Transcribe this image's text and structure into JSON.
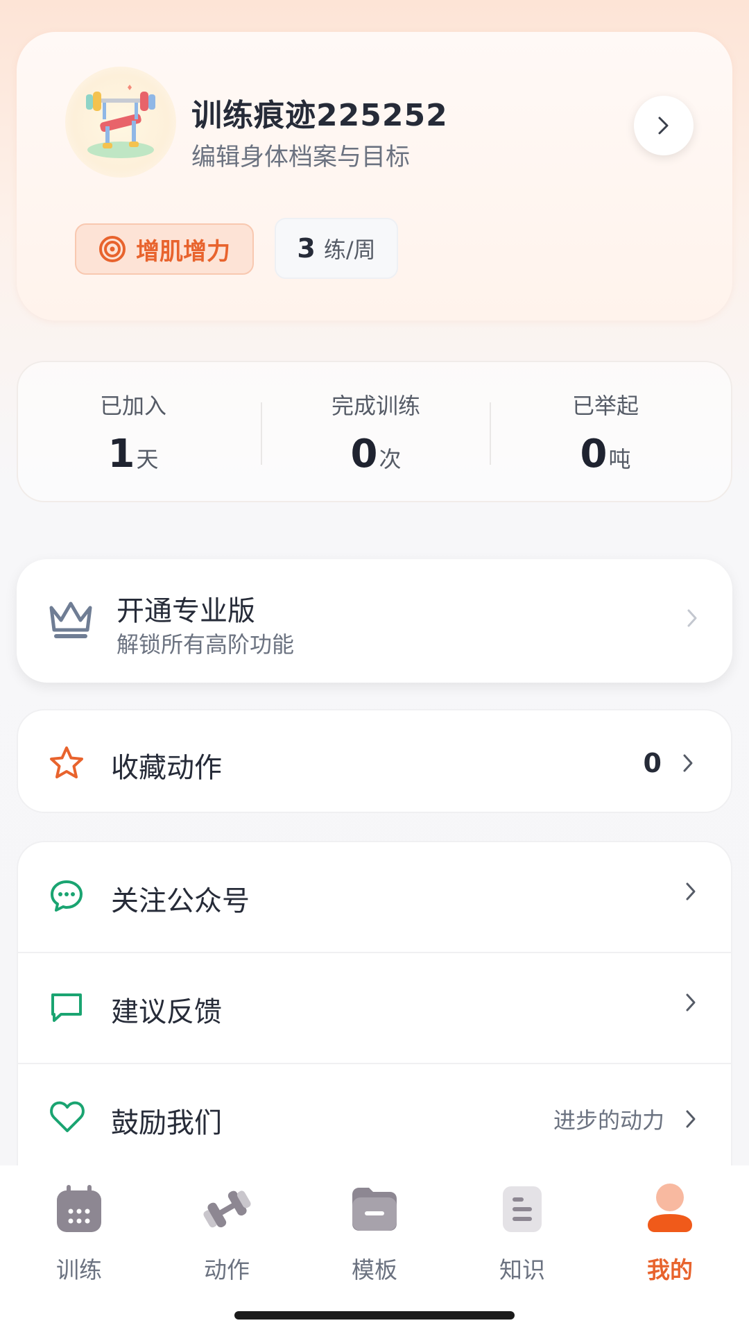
{
  "profile": {
    "username": "训练痕迹225252",
    "subtitle": "编辑身体档案与目标",
    "goal_tag": "增肌增力",
    "frequency_number": "3",
    "frequency_unit": "练/周",
    "avatar_icon": "bench-press-icon"
  },
  "stats": [
    {
      "label": "已加入",
      "value": "1",
      "unit": "天"
    },
    {
      "label": "完成训练",
      "value": "0",
      "unit": "次"
    },
    {
      "label": "已举起",
      "value": "0",
      "unit": "吨"
    }
  ],
  "pro": {
    "title": "开通专业版",
    "subtitle": "解锁所有高阶功能",
    "icon": "crown-icon"
  },
  "favorites": {
    "label": "收藏动作",
    "count": "0",
    "icon": "star-icon"
  },
  "menu": [
    {
      "label": "关注公众号",
      "hint": "",
      "icon": "chat-bubble-icon"
    },
    {
      "label": "建议反馈",
      "hint": "",
      "icon": "feedback-icon"
    },
    {
      "label": "鼓励我们",
      "hint": "进步的动力",
      "icon": "heart-icon"
    }
  ],
  "tabs": [
    {
      "label": "训练",
      "icon": "calendar-icon",
      "active": false
    },
    {
      "label": "动作",
      "icon": "dumbbell-icon",
      "active": false
    },
    {
      "label": "模板",
      "icon": "folder-icon",
      "active": false
    },
    {
      "label": "知识",
      "icon": "document-icon",
      "active": false
    },
    {
      "label": "我的",
      "icon": "person-icon",
      "active": true
    }
  ],
  "colors": {
    "accent": "#e8632d",
    "green": "#1aa471",
    "text": "#262b38",
    "muted": "#6b7280"
  }
}
